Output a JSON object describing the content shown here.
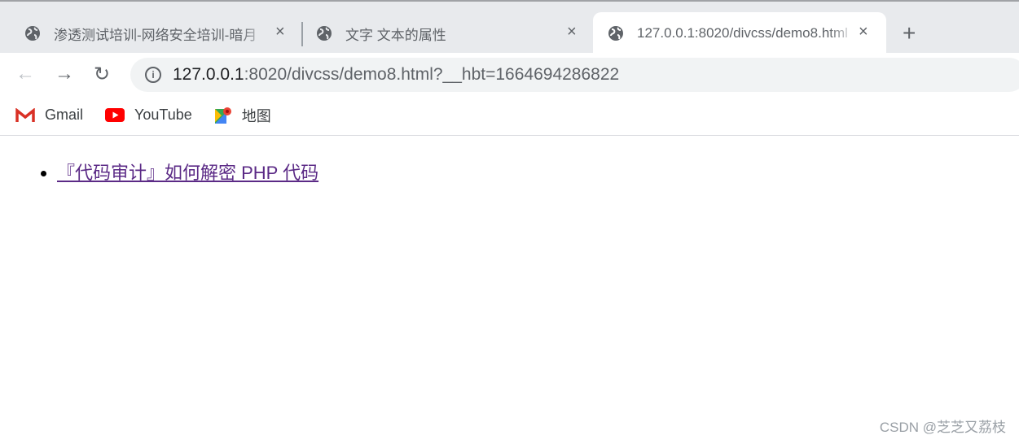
{
  "tabs": [
    {
      "title": "渗透测试培训-网络安全培训-暗月",
      "active": false
    },
    {
      "title": "文字 文本的属性",
      "active": false
    },
    {
      "title": "127.0.0.1:8020/divcss/demo8.html",
      "active": true
    }
  ],
  "icons": {
    "close": "×",
    "new_tab": "+",
    "back": "←",
    "forward": "→",
    "reload": "↻",
    "info": "i"
  },
  "address": {
    "host": "127.0.0.1",
    "rest": ":8020/divcss/demo8.html?__hbt=1664694286822"
  },
  "bookmarks": [
    {
      "label": "Gmail"
    },
    {
      "label": "YouTube"
    },
    {
      "label": "地图"
    }
  ],
  "content": {
    "links": [
      {
        "text": "『代码审计』如何解密 PHP 代码"
      }
    ]
  },
  "watermark": "CSDN @芝芝又荔枝",
  "colors": {
    "link_visited": "#5b2a86",
    "tabstrip": "#e8eaed"
  }
}
